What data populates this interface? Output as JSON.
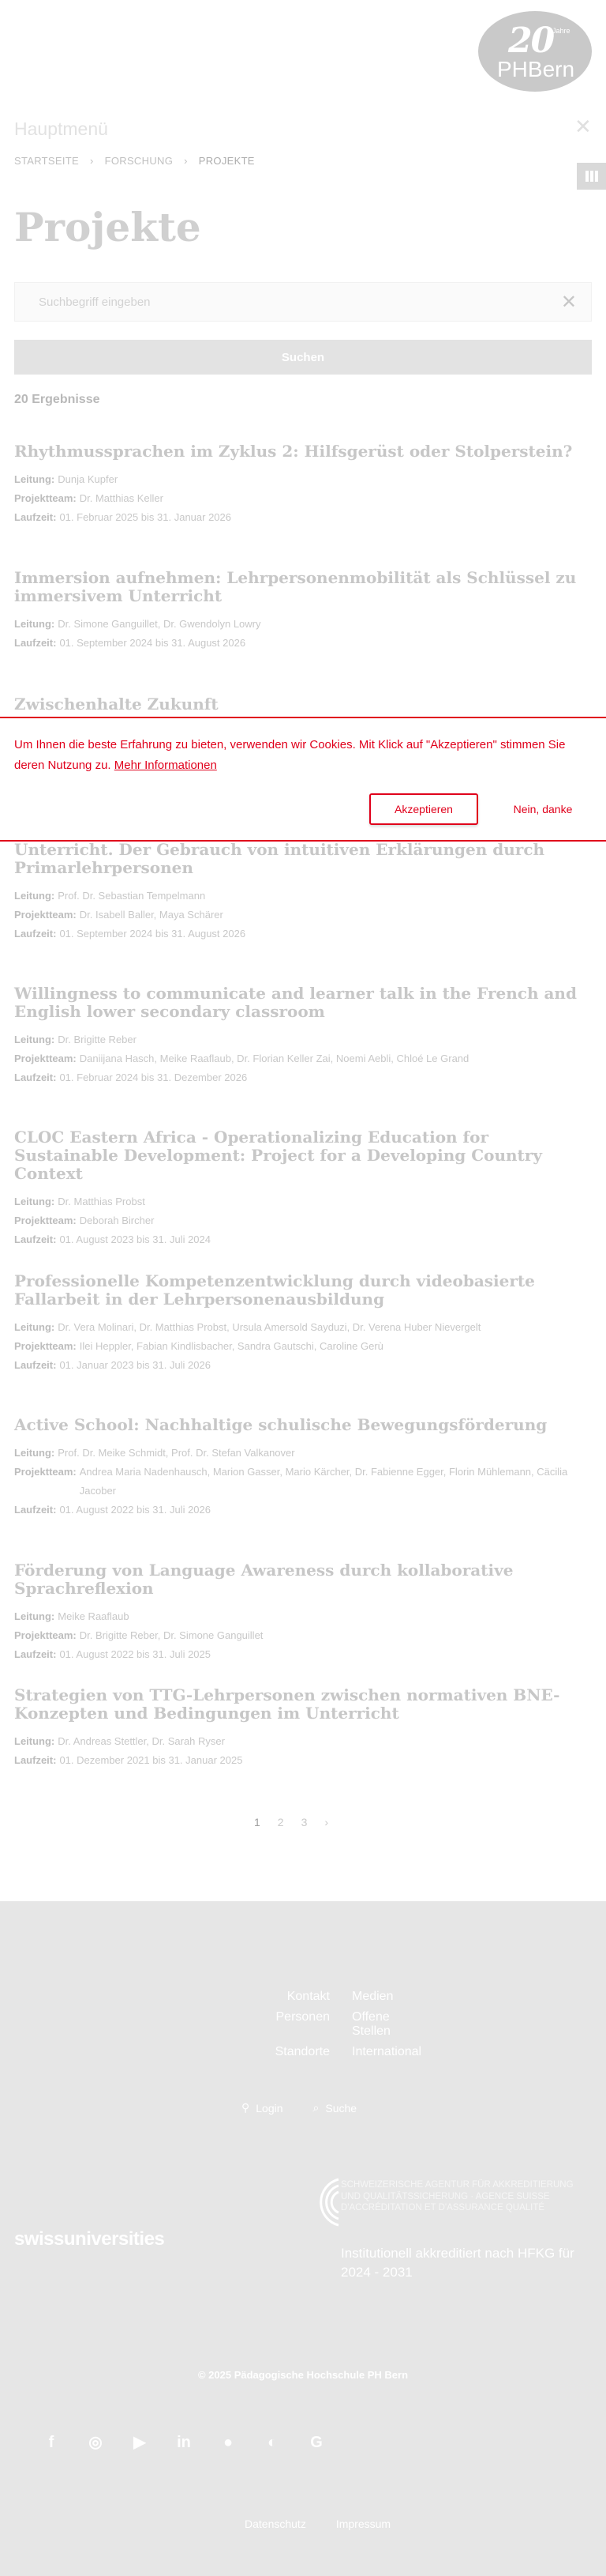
{
  "header": {
    "logo_number": "20",
    "logo_years": "Jahre",
    "logo_text_a": "PH",
    "logo_text_b": "Bern",
    "section_label": "Hauptmenü",
    "breadcrumbs": [
      "Startseite",
      "Forschung",
      "Projekte"
    ]
  },
  "page": {
    "title": "Projekte",
    "search_placeholder": "Suchbegriff eingeben",
    "search_button": "Suchen",
    "results_count": "20 Ergebnisse"
  },
  "labels": {
    "leitung": "Leitung:",
    "projektteam": "Projektteam:",
    "laufzeit": "Laufzeit:"
  },
  "projects": [
    {
      "title": "Rhythmussprachen im Zyklus 2: Hilfsgerüst oder Stolperstein?",
      "leitung": "Dunja Kupfer",
      "team": "Dr. Matthias Keller",
      "laufzeit": "01. Februar 2025 bis 31. Januar 2026"
    },
    {
      "title": "Immersion aufnehmen: Lehrpersonenmobilität als Schlüssel zu immersivem Unterricht",
      "leitung": "Dr. Simone Ganguillet, Dr. Gwendolyn Lowry",
      "laufzeit": "01. September 2024 bis 31. August 2026"
    },
    {
      "title": "Zwischenhalte Zukunft"
    },
    {
      "title": "Unterricht. Der Gebrauch von intuitiven Erklärungen durch Primarlehrpersonen",
      "leitung": "Prof. Dr. Sebastian Tempelmann",
      "team": "Dr. Isabell Baller, Maya Schärer",
      "laufzeit": "01. September 2024 bis 31. August 2026"
    },
    {
      "title": "Willingness to communicate and learner talk in the French and English lower secondary classroom",
      "leitung": "Dr. Brigitte Reber",
      "team": "Daniijana Hasch, Meike Raaflaub, Dr. Florian Keller Zai, Noemi Aebli, Chloé Le Grand",
      "laufzeit": "01. Februar 2024 bis 31. Dezember 2026"
    },
    {
      "title": "CLOC Eastern Africa - Operationalizing Education for Sustainable Development: Project for a Developing Country Context",
      "leitung": "Dr. Matthias Probst",
      "team": "Deborah Bircher",
      "laufzeit": "01. August 2023 bis 31. Juli 2024"
    },
    {
      "title": "Professionelle Kompetenzentwicklung durch videobasierte Fallarbeit in der Lehrpersonenausbildung",
      "leitung": "Dr. Vera Molinari, Dr. Matthias Probst, Ursula Amersold Sayduzi, Dr. Verena Huber Nievergelt",
      "team": "Ilei Heppler, Fabian Kindlisbacher, Sandra Gautschi, Caroline Gerù",
      "laufzeit": "01. Januar 2023 bis 31. Juli 2026"
    },
    {
      "title": "Active School: Nachhaltige schulische Bewegungsförderung",
      "leitung": "Prof. Dr. Meike Schmidt, Prof. Dr. Stefan Valkanover",
      "team": "Andrea Maria Nadenhausch, Marion Gasser, Mario Kärcher, Dr. Fabienne Egger, Florin Mühlemann, Cäcilia Jacober",
      "laufzeit": "01. August 2022 bis 31. Juli 2026"
    },
    {
      "title": "Förderung von Language Awareness durch kollaborative Sprachreflexion",
      "leitung": "Meike Raaflaub",
      "team": "Dr. Brigitte Reber, Dr. Simone Ganguillet",
      "laufzeit": "01. August 2022 bis 31. Juli 2025"
    },
    {
      "title": "Strategien von TTG-Lehrpersonen zwischen normativen BNE-Konzepten und Bedingungen im Unterricht",
      "leitung": "Dr. Andreas Stettler, Dr. Sarah Ryser",
      "laufzeit": "01. Dezember 2021 bis 31. Januar 2025"
    }
  ],
  "cookie": {
    "text": "Um Ihnen die beste Erfahrung zu bieten, verwenden wir Cookies. Mit Klick auf \"Akzeptieren\" stimmen Sie deren Nutzung zu.",
    "link": "Mehr Informationen",
    "accept": "Akzeptieren",
    "decline": "Nein, danke",
    "accent": "#e0001b"
  },
  "pagination": [
    "1",
    "2",
    "3",
    "›"
  ],
  "footer": {
    "links": [
      "Kontakt",
      "Medien",
      "Personen",
      "Offene Stellen",
      "Standorte",
      "International"
    ],
    "login": "Login",
    "search": "Suche",
    "swiss": "swissuniversities",
    "accr_text": "SCHWEIZERISCHE AGENTUR FÜR AKKREDITIERUNG UND QUALITÄTSSICHERUNG · AGENCE SUISSE D'ACCRÉDITATION ET D'ASSURANCE QUALITÉ",
    "accr_main": "Institutionell akkreditiert nach HFKG für 2024 - 2031",
    "copyright": "© 2025 Pädagogische Hochschule PH Bern",
    "social": [
      "facebook-icon",
      "instagram-icon",
      "youtube-icon",
      "linkedin-icon",
      "flickr-icon",
      "reddit-icon",
      "google-icon"
    ],
    "bottom_links": [
      "Datenschutz",
      "Impressum"
    ]
  }
}
